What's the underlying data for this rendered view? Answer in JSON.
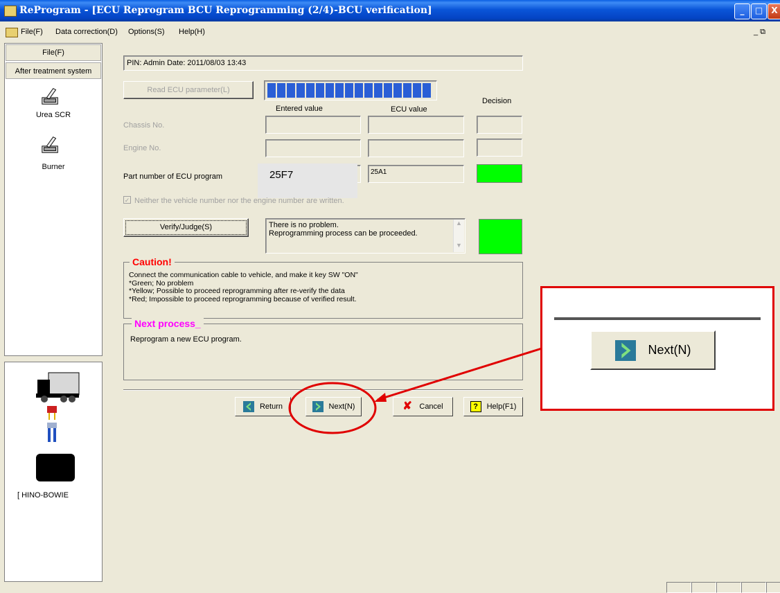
{
  "window": {
    "title": "ReProgram - [ECU Reprogram BCU Reprogramming (2/4)-BCU verification]",
    "btn_min": "_",
    "btn_max": "□",
    "btn_close": "X"
  },
  "menu": {
    "items": [
      "File(F)",
      "Data correction(D)",
      "Options(S)",
      "Help(H)"
    ],
    "right_controls": "_ ⧉"
  },
  "sidebar": {
    "file_button": "File(F)",
    "category": "After treatment system",
    "items": [
      {
        "label": "Urea SCR",
        "icon": "urea-scr-icon"
      },
      {
        "label": "Burner",
        "icon": "burner-icon"
      }
    ]
  },
  "connection": {
    "label": "[ HINO-BOWIE"
  },
  "form": {
    "info_line": "PIN: Admin  Date: 2011/08/03 13:43",
    "read_button": "Read ECU parameter(L)",
    "progress_fraction": 1.0,
    "col_entered": "Entered value",
    "col_ecu": "ECU value",
    "col_decision": "Decision",
    "rows": [
      {
        "label": "Chassis No.",
        "entered": "",
        "ecu": "",
        "decision": "none",
        "disabled": true
      },
      {
        "label": "Engine No.",
        "entered": "",
        "ecu": "",
        "decision": "none",
        "disabled": true
      },
      {
        "label": "Part number of ECU program",
        "entered": "25F7",
        "ecu": "25A1",
        "decision": "green",
        "disabled": false
      }
    ],
    "checkbox_label": "Neither the vehicle number nor the engine number are written.",
    "verify_button": "Verify/Judge(S)",
    "result_line1": "There is no problem.",
    "result_line2": "Reprogramming process can be proceeded.",
    "result_status": "green"
  },
  "caution": {
    "title": "Caution!",
    "lines": [
      "Connect the communication cable to vehicle, and make it key SW \"ON\"",
      "*Green; No problem",
      "*Yellow; Possible to proceed reprogramming after re-verify the data",
      "*Red; Impossible to proceed reprogramming because of verified result."
    ]
  },
  "next_process": {
    "title": "Next process_",
    "text": "Reprogram a new ECU program."
  },
  "buttons": {
    "return": "Return",
    "next": "Next(N)",
    "cancel": "Cancel",
    "help": "Help(F1)"
  },
  "callout": {
    "next_zoomed": "Next(N)"
  },
  "colors": {
    "status_green": "#00ff00",
    "caution_title": "#ff0000",
    "next_title": "#ff00ff",
    "annotation_red": "#e00000",
    "progress_blue": "#2a5fd6"
  }
}
